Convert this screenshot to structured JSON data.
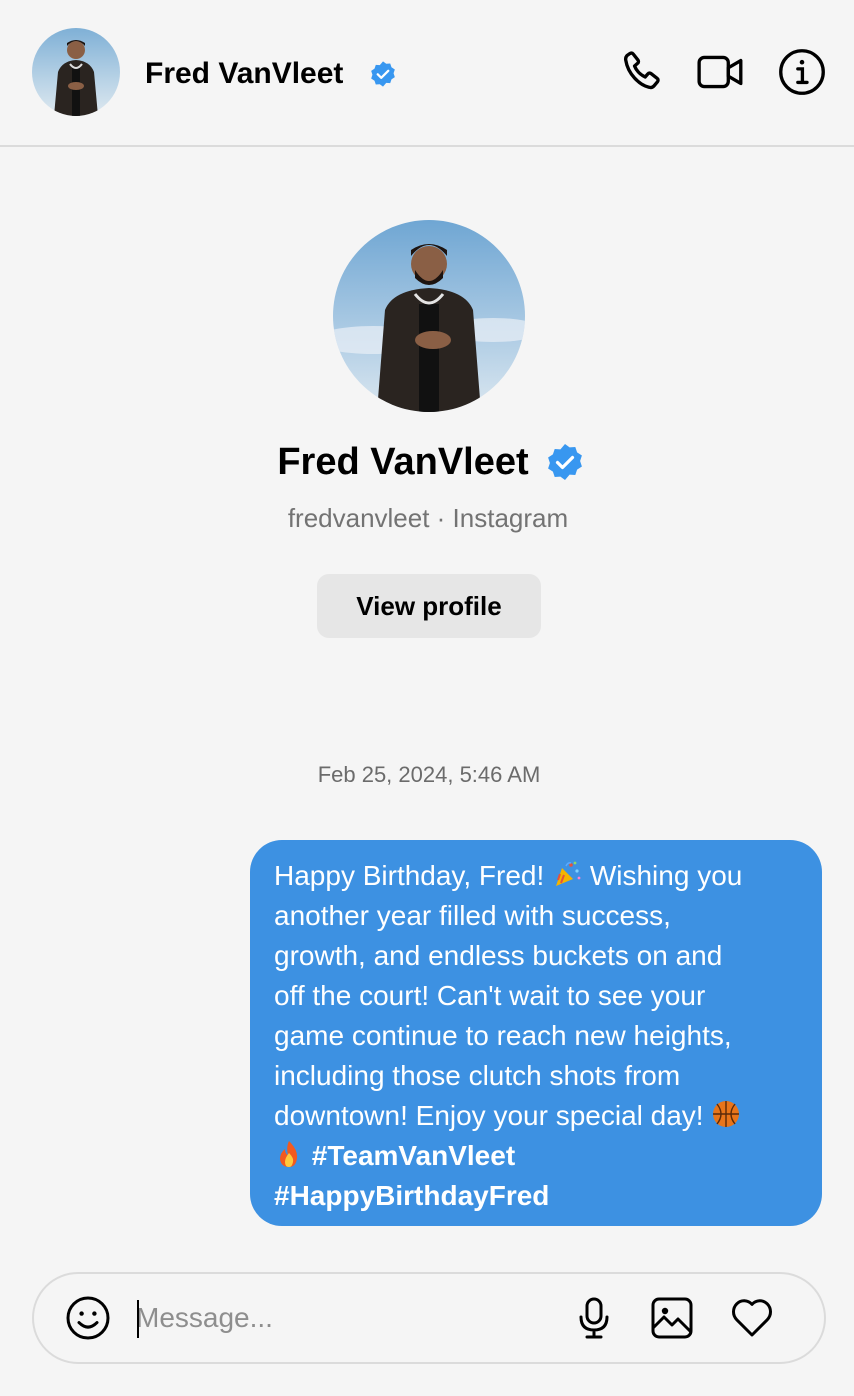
{
  "header": {
    "name": "Fred VanVleet",
    "verified": true,
    "actions": [
      "phone-icon",
      "video-camera-icon",
      "info-icon"
    ]
  },
  "profile": {
    "name": "Fred VanVleet",
    "subtitle": "fredvanvleet · Instagram",
    "view_profile_label": "View profile"
  },
  "conversation": {
    "timestamp": "Feb 25, 2024, 5:46 AM",
    "messages": [
      {
        "sender": "me",
        "lines": [
          "Happy Birthday, Fred!",
          "Wishing you",
          "another year filled with success,",
          "growth, and endless buckets on and",
          "off the court! Can't wait to see your",
          "game continue to reach new heights,",
          "including those clutch shots from",
          "downtown! Enjoy your special day!",
          "#TeamVanVleet",
          "#HappyBirthdayFred"
        ],
        "emojis": [
          "party-popper-icon",
          "basketball-icon",
          "fire-icon"
        ]
      }
    ]
  },
  "composer": {
    "placeholder": "Message...",
    "value": "",
    "icons": [
      "smiley-icon",
      "microphone-icon",
      "image-icon",
      "heart-icon"
    ]
  },
  "colors": {
    "background": "#f5f5f5",
    "bubble": "#3d91e2",
    "verified": "#3897f0",
    "button": "#e6e6e6"
  }
}
